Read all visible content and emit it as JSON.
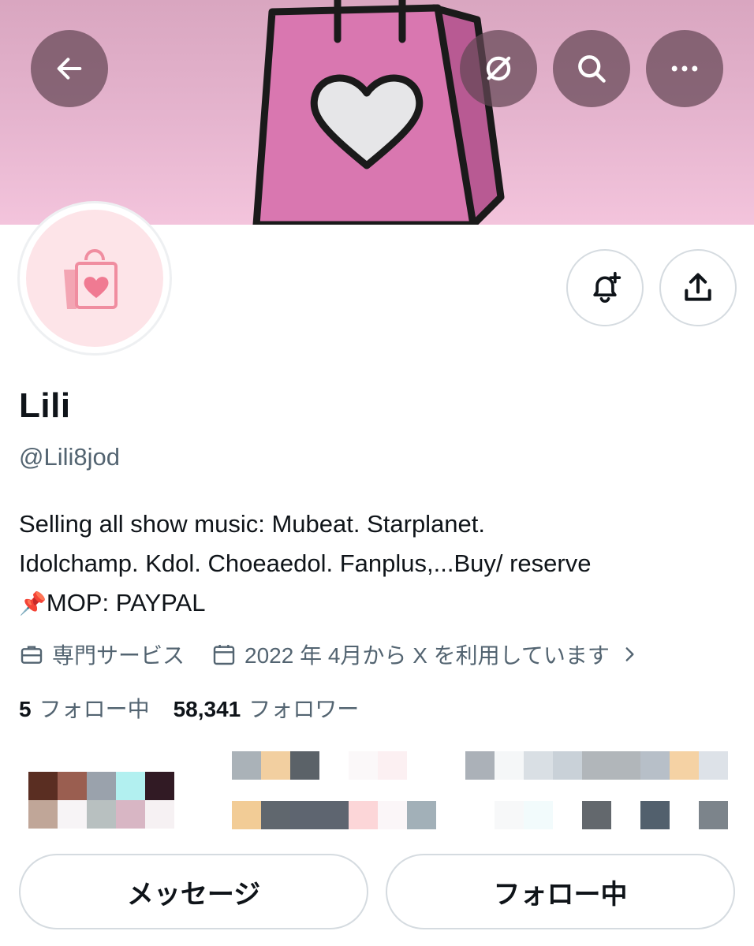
{
  "header": {
    "back_icon": "arrow-left-icon",
    "grok_icon": "grok-icon",
    "search_icon": "search-icon",
    "more_icon": "more-horizontal-icon"
  },
  "profile": {
    "display_name": "Lili",
    "handle": "@Lili8jod",
    "bio_lines": [
      "Selling all show music: Mubeat. Starplanet.",
      "Idolchamp. Kdol. Choeaedol. Fanplus,...Buy/ reserve",
      "MOP: PAYPAL"
    ],
    "bio_pin_emoji": "📌",
    "category": "専門サービス",
    "joined": "2022 年 4月から X を利用しています",
    "following_count": "5",
    "following_label": "フォロー中",
    "followers_count": "58,341",
    "followers_label": "フォロワー"
  },
  "actions": {
    "notify_icon": "bell-plus-icon",
    "share_icon": "share-icon",
    "message_label": "メッセージ",
    "following_button_label": "フォロー中"
  },
  "colors": {
    "banner_pink": "#e6b5cf",
    "bag_pink": "#d977b0",
    "avatar_bg": "#fde4e8",
    "secondary_text": "#536471"
  }
}
